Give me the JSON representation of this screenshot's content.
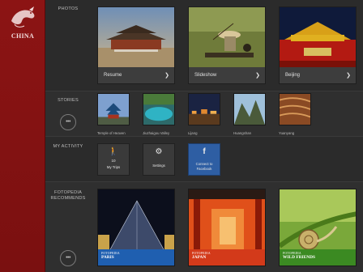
{
  "sidebar": {
    "brand": "CHINA",
    "logo_icon": "dragon-logo-icon",
    "accent": "#8c1414"
  },
  "photos": {
    "label": "PHOTOS",
    "tiles": [
      {
        "caption": "Resume"
      },
      {
        "caption": "Slideshow"
      },
      {
        "caption": "Beijing"
      }
    ]
  },
  "stories": {
    "label": "STORIES",
    "more": "•••",
    "items": [
      {
        "label": "Temple of Heaven"
      },
      {
        "label": "Jiuzhaigou Valley"
      },
      {
        "label": "Lijang"
      },
      {
        "label": "Huangshan"
      },
      {
        "label": "Yuanyang"
      }
    ]
  },
  "activity": {
    "label": "MY ACTIVITY",
    "trips": {
      "count": "10",
      "label": "My Trips",
      "icon": "walking-person-icon"
    },
    "settings": {
      "label": "Settings",
      "icon": "gear-icon"
    },
    "facebook": {
      "label": "Connect to Facebook",
      "icon": "facebook-icon",
      "color": "#2e5ea3"
    }
  },
  "recommends": {
    "label": "FOTOPEDIA RECOMMENDS",
    "more": "•••",
    "items": [
      {
        "brand": "FOTOPEDIA",
        "place": "PARIS",
        "color": "#1f5fb0"
      },
      {
        "brand": "FOTOPEDIA",
        "place": "JAPAN",
        "color": "#d33a1a"
      },
      {
        "brand": "FOTOPEDIA",
        "place": "WILD FRIENDS",
        "color": "#3b8a22"
      }
    ]
  }
}
